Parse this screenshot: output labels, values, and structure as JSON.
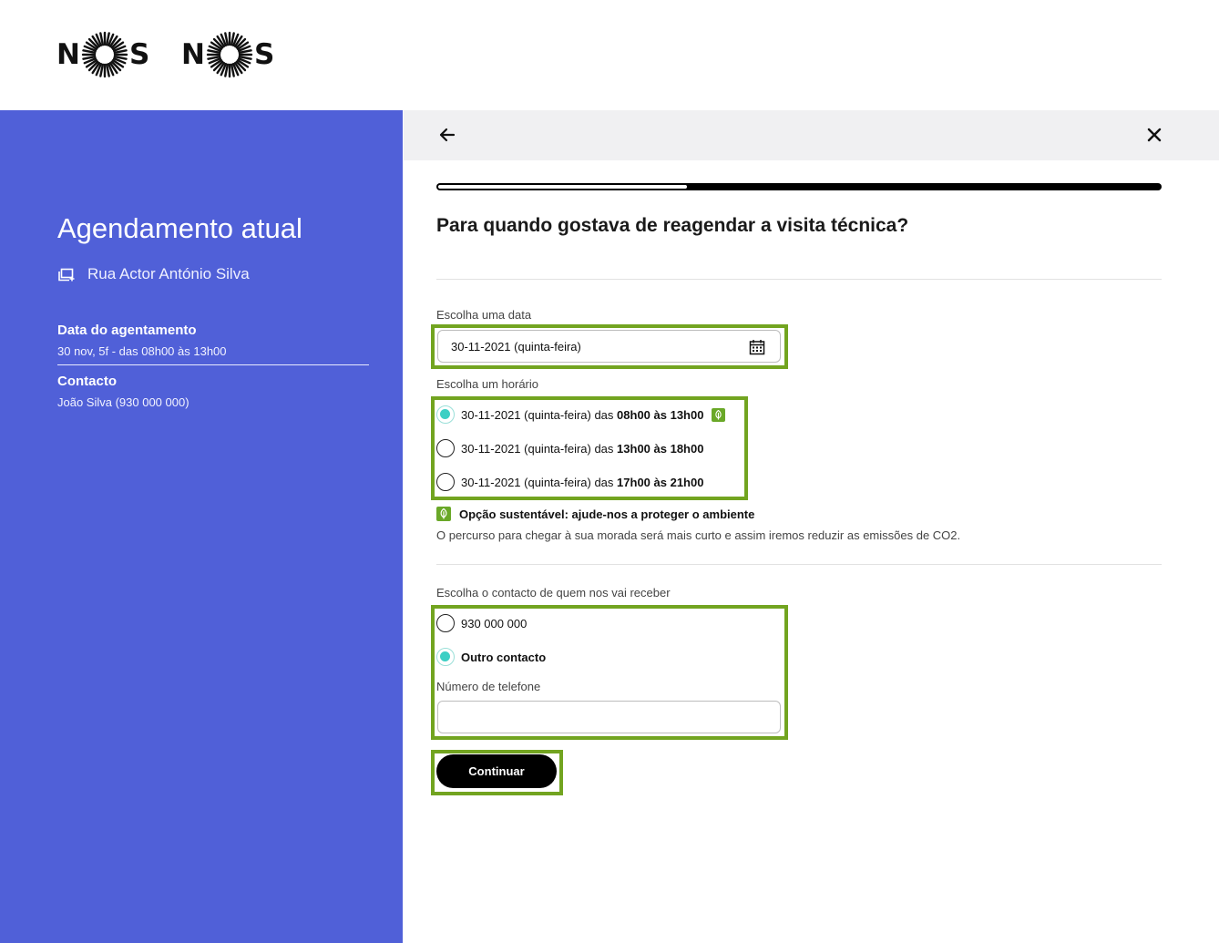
{
  "header": {
    "logos": [
      {
        "left": "N",
        "right": "S",
        "name": "NOS"
      },
      {
        "left": "N",
        "right": "S",
        "name": "NOS"
      }
    ]
  },
  "sidebar": {
    "title": "Agendamento atual",
    "address_icon": "address-icon",
    "address": "Rua Actor António Silva",
    "date_label": "Data do agentamento",
    "date_value": "30 nov, 5f - das 08h00 às 13h00",
    "contact_label": "Contacto",
    "contact_value": "João Silva (930 000 000)"
  },
  "topbar": {
    "back_icon": "arrow-left-icon",
    "close_icon": "close-icon"
  },
  "progress": {
    "completed_fraction": 0.345
  },
  "main": {
    "question": "Para quando gostava de reagendar a visita técnica?",
    "date_field": {
      "label": "Escolha uma data",
      "value": "30-11-2021 (quinta-feira)",
      "icon": "calendar-icon"
    },
    "time_field": {
      "label": "Escolha um horário",
      "options": [
        {
          "prefix": "30-11-2021 (quinta-feira) das ",
          "range": "08h00 às 13h00",
          "selected": true,
          "eco": true
        },
        {
          "prefix": "30-11-2021 (quinta-feira) das ",
          "range": "13h00 às 18h00",
          "selected": false,
          "eco": false
        },
        {
          "prefix": "30-11-2021 (quinta-feira) das ",
          "range": "17h00 às 21h00",
          "selected": false,
          "eco": false
        }
      ]
    },
    "eco_note": {
      "title": "Opção sustentável: ajude-nos a proteger o ambiente",
      "description": "O percurso para chegar à sua morada será mais curto e assim iremos reduzir as emissões de CO2."
    },
    "contact_field": {
      "label": "Escolha o contacto de quem nos vai receber",
      "options": [
        {
          "label": "930 000 000",
          "selected": false
        },
        {
          "label": "Outro contacto",
          "selected": true
        }
      ],
      "phone_label": "Número de telefone",
      "phone_value": ""
    },
    "continue_label": "Continuar"
  },
  "colors": {
    "sidebar_bg": "#5060d8",
    "highlight": "#72a420",
    "radio_selected": "#3ccfc4",
    "eco_green": "#6aa828",
    "topbar_bg": "#f0f0f2"
  }
}
